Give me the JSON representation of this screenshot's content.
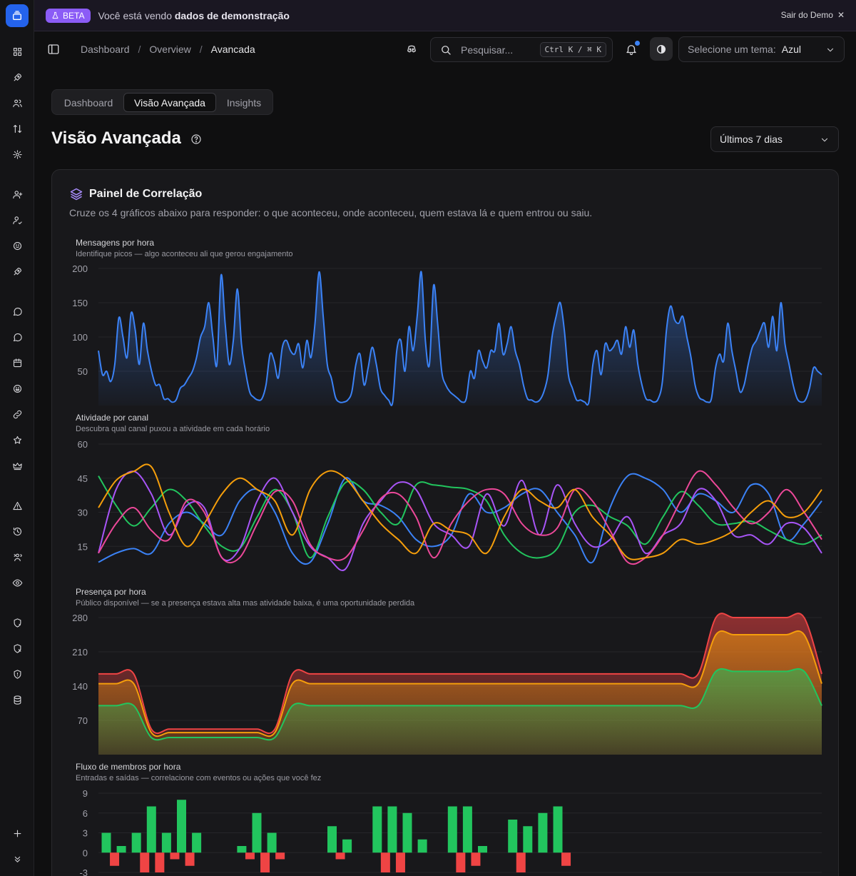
{
  "banner": {
    "badge": "BETA",
    "text_prefix": "Você está vendo ",
    "text_bold": "dados de demonstração",
    "exit_label": "Sair do Demo"
  },
  "breadcrumb": [
    "Dashboard",
    "Overview",
    "Avancada"
  ],
  "search": {
    "placeholder": "Pesquisar...",
    "shortcut": "Ctrl K / ⌘ K"
  },
  "theme": {
    "label": "Selecione um tema:",
    "value": "Azul"
  },
  "tabs": [
    {
      "label": "Dashboard",
      "active": false
    },
    {
      "label": "Visão Avançada",
      "active": true
    },
    {
      "label": "Insights",
      "active": false
    }
  ],
  "page_title": "Visão Avançada",
  "range_select": "Últimos 7 dias",
  "card": {
    "title": "Painel de Correlação",
    "subtitle": "Cruze os 4 gráficos abaixo para responder: o que aconteceu, onde aconteceu, quem estava lá e quem entrou ou saiu."
  },
  "colors": {
    "accent": "#2463eb",
    "line_blue": "#3b82f6",
    "green": "#22c55e",
    "red": "#ef4444",
    "orange": "#f59e0b",
    "purple": "#a855f7",
    "pink": "#ec4899",
    "cyan": "#0ea5e9",
    "beta": "#8b5cf6"
  },
  "sidebar_icons": [
    "grid-icon",
    "rocket-icon",
    "users-icon",
    "arrows-sort-icon",
    "settings-icon",
    "user-plus-icon",
    "user-check-icon",
    "smile-icon",
    "rocket-alt-icon",
    "message-icon",
    "message-alt-icon",
    "calendar-icon",
    "emoji-icon",
    "link-icon",
    "star-icon",
    "crown-icon",
    "alert-icon",
    "history-icon",
    "users-group-icon",
    "eye-icon",
    "shield-refresh-icon",
    "shield-x-icon",
    "shield-icon",
    "database-icon",
    "plus-icon",
    "chevrons-down-icon"
  ],
  "chart_data": [
    {
      "type": "area",
      "title": "Mensagens por hora",
      "subtitle": "Identifique picos — algo aconteceu ali que gerou engajamento",
      "yticks": [
        50,
        100,
        150,
        200
      ],
      "ylim": [
        0,
        200
      ],
      "grid": true,
      "series": [
        {
          "values": [
            80,
            45,
            50,
            35,
            60,
            128,
            100,
            70,
            135,
            110,
            60,
            120,
            80,
            50,
            30,
            30,
            10,
            10,
            5,
            8,
            25,
            30,
            40,
            50,
            70,
            100,
            115,
            150,
            100,
            60,
            190,
            120,
            60,
            95,
            170,
            90,
            50,
            20,
            12,
            8,
            10,
            30,
            75,
            65,
            40,
            85,
            95,
            80,
            75,
            90,
            55,
            95,
            70,
            120,
            195,
            130,
            60,
            40,
            12,
            5,
            5,
            8,
            20,
            60,
            75,
            30,
            55,
            85,
            60,
            25,
            15,
            8,
            5,
            80,
            95,
            50,
            115,
            80,
            130,
            195,
            95,
            60,
            175,
            120,
            50,
            30,
            20,
            15,
            10,
            5,
            10,
            50,
            40,
            80,
            65,
            55,
            80,
            80,
            120,
            75,
            90,
            115,
            80,
            60,
            30,
            10,
            8,
            5,
            8,
            20,
            45,
            100,
            130,
            150,
            110,
            45,
            25,
            8,
            8,
            5,
            5,
            60,
            80,
            45,
            90,
            80,
            85,
            95,
            75,
            115,
            85,
            110,
            60,
            30,
            10,
            8,
            5,
            10,
            35,
            110,
            145,
            125,
            120,
            130,
            100,
            70,
            30,
            12,
            8,
            5,
            10,
            55,
            75,
            65,
            120,
            80,
            50,
            20,
            30,
            60,
            85,
            95,
            110,
            120,
            85,
            130,
            80,
            150,
            90,
            60,
            30,
            10,
            5,
            8,
            25,
            55,
            50,
            45
          ]
        }
      ]
    },
    {
      "type": "line",
      "title": "Atividade por canal",
      "subtitle": "Descubra qual canal puxou a atividade em cada horário",
      "yticks": [
        15,
        30,
        45,
        60
      ],
      "ylim": [
        0,
        60
      ],
      "grid": true,
      "series": [
        {
          "color": "#3b82f6",
          "values": [
            8,
            12,
            14,
            12,
            25,
            30,
            25,
            20,
            35,
            40,
            30,
            12,
            8,
            25,
            45,
            35,
            33,
            28,
            18,
            15,
            20,
            38,
            30,
            32,
            38,
            40,
            30,
            20,
            8,
            32,
            46,
            45,
            40,
            30,
            38,
            35,
            30,
            42,
            38,
            18,
            25,
            35
          ]
        },
        {
          "color": "#22c55e",
          "values": [
            46,
            33,
            24,
            32,
            40,
            35,
            24,
            15,
            14,
            28,
            40,
            30,
            10,
            28,
            43,
            40,
            30,
            25,
            42,
            42,
            41,
            40,
            35,
            20,
            12,
            10,
            14,
            30,
            33,
            28,
            24,
            16,
            28,
            39,
            33,
            25,
            25,
            26,
            22,
            18,
            16,
            20
          ]
        },
        {
          "color": "#a855f7",
          "values": [
            12,
            40,
            48,
            38,
            20,
            33,
            32,
            10,
            14,
            35,
            45,
            30,
            15,
            10,
            5,
            25,
            35,
            43,
            40,
            25,
            20,
            15,
            38,
            24,
            44,
            20,
            42,
            25,
            15,
            18,
            28,
            12,
            20,
            25,
            40,
            35,
            20,
            20,
            16,
            25,
            23,
            12
          ]
        },
        {
          "color": "#ec4899",
          "values": [
            12,
            25,
            32,
            22,
            18,
            35,
            30,
            10,
            10,
            25,
            39,
            35,
            16,
            10,
            10,
            22,
            36,
            38,
            28,
            10,
            25,
            35,
            40,
            38,
            25,
            20,
            23,
            40,
            35,
            22,
            8,
            10,
            20,
            35,
            48,
            42,
            32,
            25,
            30,
            40,
            30,
            18
          ]
        },
        {
          "color": "#f59e0b",
          "values": [
            32,
            44,
            48,
            50,
            30,
            15,
            25,
            38,
            45,
            40,
            35,
            20,
            40,
            48,
            45,
            35,
            25,
            18,
            12,
            25,
            22,
            20,
            12,
            28,
            40,
            35,
            32,
            40,
            28,
            20,
            10,
            10,
            12,
            18,
            16,
            18,
            22,
            30,
            35,
            28,
            30,
            40
          ]
        }
      ]
    },
    {
      "type": "area",
      "title": "Presença por hora",
      "subtitle": "Público disponível — se a presença estava alta mas atividade baixa, é uma oportunidade perdida",
      "yticks": [
        70,
        140,
        210,
        280
      ],
      "ylim": [
        0,
        280
      ],
      "stacked": true,
      "grid": true,
      "series": [
        {
          "color": "#22c55e",
          "values": [
            100,
            100,
            100,
            35,
            35,
            35,
            35,
            35,
            35,
            35,
            35,
            100,
            100,
            100,
            100,
            100,
            100,
            100,
            100,
            100,
            100,
            100,
            100,
            100,
            100,
            100,
            100,
            100,
            100,
            100,
            100,
            100,
            100,
            100,
            100,
            170,
            170,
            170,
            170,
            170,
            170,
            100
          ]
        },
        {
          "color": "#f59e0b",
          "values": [
            145,
            145,
            145,
            45,
            45,
            45,
            45,
            45,
            45,
            45,
            45,
            145,
            145,
            145,
            145,
            145,
            145,
            145,
            145,
            145,
            145,
            145,
            145,
            145,
            145,
            145,
            145,
            145,
            145,
            145,
            145,
            145,
            145,
            145,
            145,
            245,
            245,
            245,
            245,
            245,
            245,
            145
          ]
        },
        {
          "color": "#ef4444",
          "values": [
            165,
            165,
            165,
            52,
            52,
            52,
            52,
            52,
            52,
            52,
            52,
            165,
            165,
            165,
            165,
            165,
            165,
            165,
            165,
            165,
            165,
            165,
            165,
            165,
            165,
            165,
            165,
            165,
            165,
            165,
            165,
            165,
            165,
            165,
            165,
            280,
            280,
            280,
            280,
            280,
            280,
            165
          ]
        }
      ]
    },
    {
      "type": "bar",
      "title": "Fluxo de membros por hora",
      "subtitle": "Entradas e saídas — correlacione com eventos ou ações que você fez",
      "yticks": [
        -3,
        0,
        3,
        6,
        9
      ],
      "ylim": [
        -3,
        9
      ],
      "grid": true,
      "series": [
        {
          "name": "entradas",
          "color": "#22c55e",
          "values": [
            3,
            1,
            3,
            7,
            3,
            8,
            3,
            0,
            0,
            1,
            6,
            3,
            0,
            0,
            0,
            4,
            2,
            0,
            7,
            7,
            6,
            2,
            0,
            7,
            7,
            1,
            0,
            5,
            4,
            6,
            7,
            0,
            0,
            0,
            0,
            0,
            0,
            0,
            0,
            0,
            0,
            0,
            0,
            0,
            0,
            0,
            0,
            0
          ]
        },
        {
          "name": "saídas",
          "color": "#ef4444",
          "values": [
            -2,
            0,
            -3,
            -3,
            -1,
            -2,
            0,
            0,
            0,
            -1,
            -3,
            -1,
            0,
            0,
            0,
            -1,
            0,
            0,
            -3,
            -3,
            0,
            0,
            0,
            -3,
            -2,
            0,
            0,
            -3,
            0,
            0,
            -2,
            0,
            0,
            0,
            0,
            0,
            0,
            0,
            0,
            0,
            0,
            0,
            0,
            0,
            0,
            0,
            0,
            0
          ]
        }
      ]
    }
  ]
}
